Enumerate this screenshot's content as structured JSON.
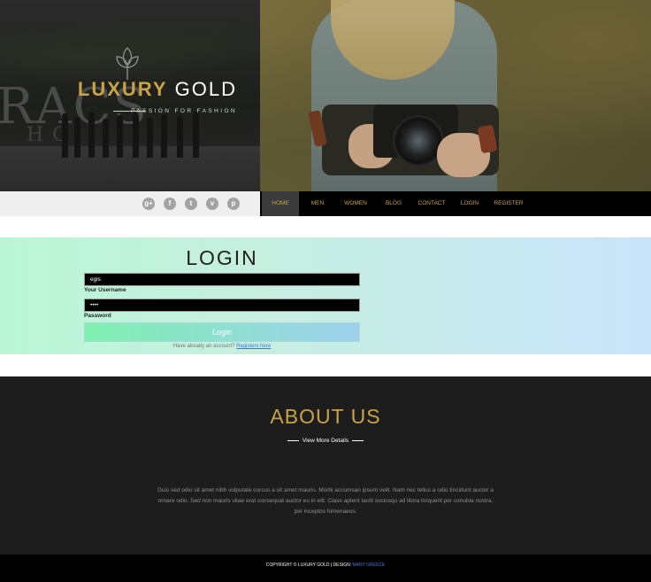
{
  "brand": {
    "name_gold": "LUXURY",
    "name_white": "GOLD",
    "tagline": "PASSION FOR FASHION"
  },
  "social": {
    "icons": [
      "google-plus-icon",
      "facebook-icon",
      "twitter-icon",
      "vimeo-icon",
      "pinterest-icon"
    ],
    "glyphs": [
      "g+",
      "f",
      "t",
      "v",
      "p"
    ]
  },
  "nav": {
    "items": [
      {
        "label": "HOME",
        "active": true
      },
      {
        "label": "MEN",
        "active": false
      },
      {
        "label": "WOMEN",
        "active": false
      },
      {
        "label": "BLOG",
        "active": false
      },
      {
        "label": "CONTACT",
        "active": false
      },
      {
        "label": "LOGIN",
        "active": false
      },
      {
        "label": "REGISTER",
        "active": false
      }
    ]
  },
  "login": {
    "title": "LOGIN",
    "username_value": "egis",
    "username_label": "Your Username",
    "password_value": "••••",
    "password_label": "Password",
    "button_label": "Login",
    "note": "Have already an account?",
    "register_link": "Registers here"
  },
  "about": {
    "title": "ABOUT US",
    "subtitle": "View More Details",
    "body": "Duis sed odio sit amet nibh vulputate cursus a sit amet mauris. Morbi accumsan ipsum velit. Nam nec tellus a odio tincidunt auctor a ornare odio. Sed non mauris vitae erat consequat auctor eu in elit. Class aptent taciti sociosqu ad litora torquent per conubia nostra, per inceptos himenaeos."
  },
  "footer": {
    "copyright": "COPYRIGHT © LUXURY GOLD | DESIGN:",
    "designer": "MARY GREECE"
  },
  "colors": {
    "gold": "#c9a24a",
    "link": "#3b7bd4",
    "dark": "#1d1d1d"
  }
}
